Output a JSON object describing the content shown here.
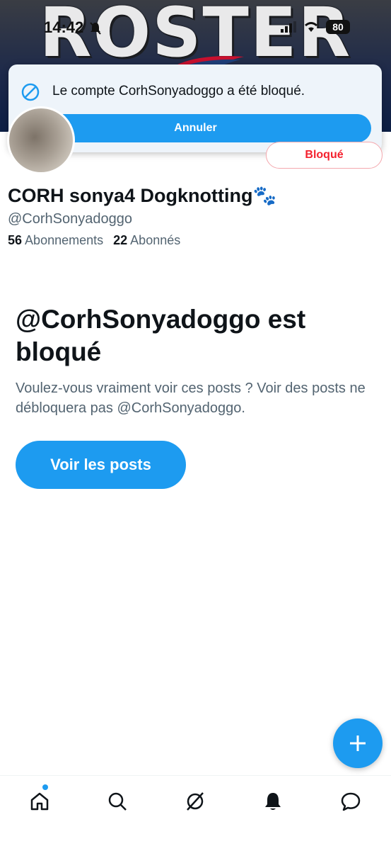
{
  "banner": {
    "title": "ROSTER"
  },
  "status_bar": {
    "time": "14:42",
    "battery": "80"
  },
  "toast": {
    "message": "Le compte CorhSonyadoggo a été bloqué.",
    "undo_label": "Annuler"
  },
  "profile": {
    "blocked_label": "Bloqué",
    "display_name": "CORH sonya4 Dogknotting🐾",
    "handle": "@CorhSonyadoggo",
    "following_count": "56",
    "following_label": "Abonnements",
    "followers_count": "22",
    "followers_label": "Abonnés"
  },
  "blocked_notice": {
    "title": "@CorhSonyadoggo est bloqué",
    "description": "Voulez-vous vraiment voir ces posts ? Voir des posts ne débloquera pas @CorhSonyadoggo.",
    "view_posts_label": "Voir les posts"
  },
  "colors": {
    "accent": "#1d9bf0",
    "danger": "#f4212e",
    "secondary_text": "#536471"
  },
  "icons": {
    "toast": "blocked-icon",
    "fab": "plus-icon",
    "nav": [
      "home-icon",
      "search-icon",
      "grok-icon",
      "bell-icon",
      "messages-icon"
    ]
  }
}
